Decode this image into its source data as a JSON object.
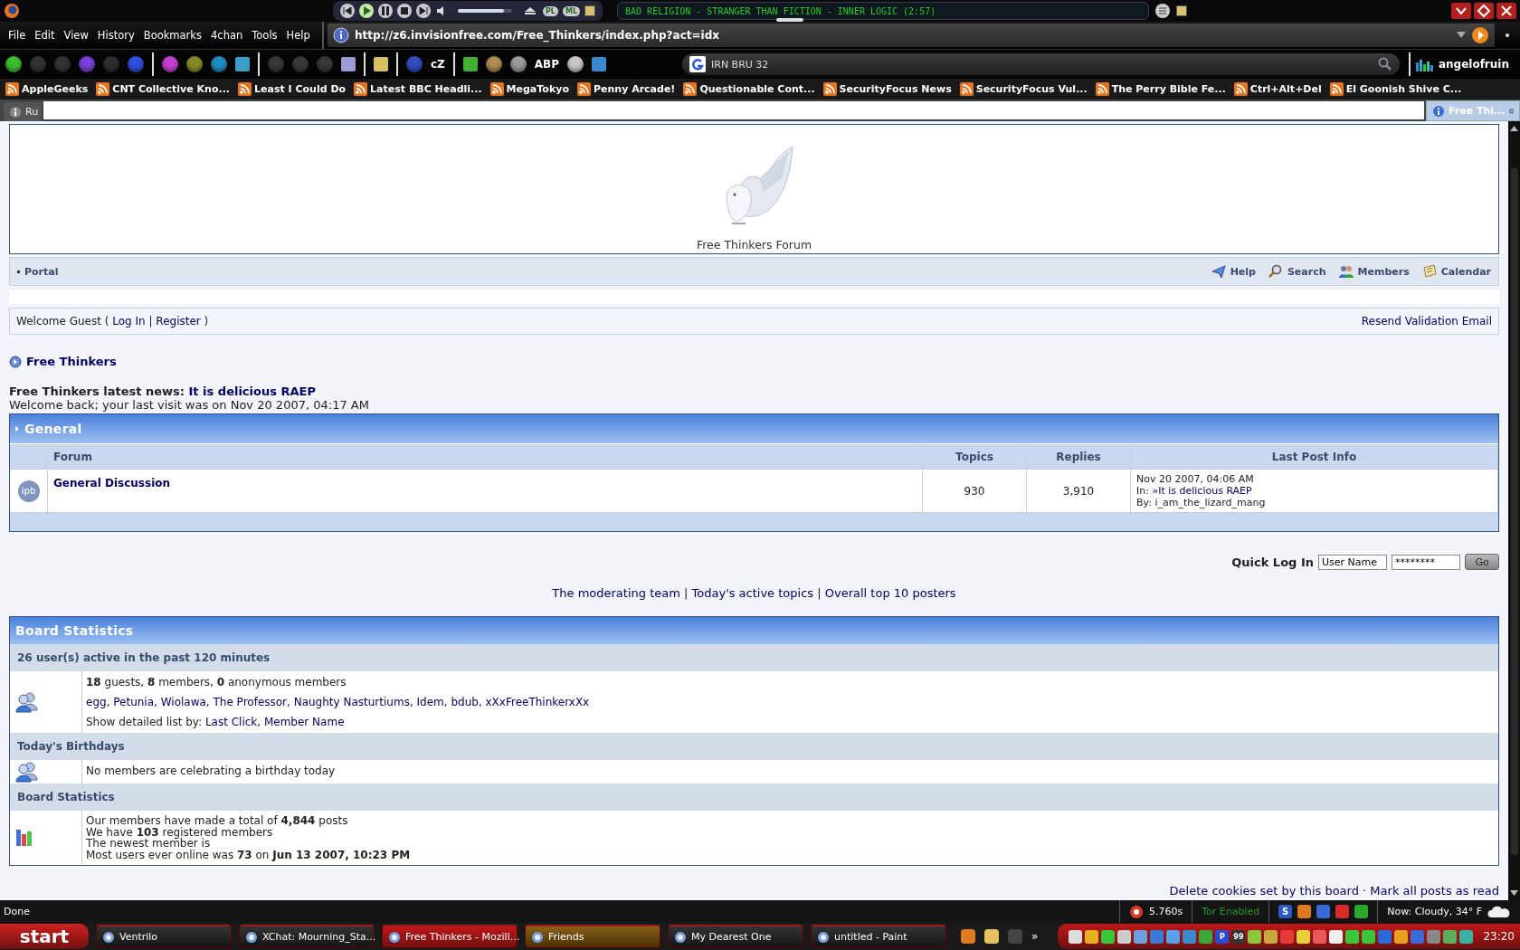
{
  "player": {
    "buttons": [
      {
        "kind": "prev"
      },
      {
        "kind": "play"
      },
      {
        "kind": "pause"
      },
      {
        "kind": "stop"
      },
      {
        "kind": "next"
      }
    ],
    "volume": {
      "level": 0.85
    },
    "labels": [
      "PL",
      "ML"
    ],
    "track": "BAD RELIGION - STRANGER THAN FICTION - INNER LOGIC (2:57)",
    "seek": {
      "level": 0.31
    }
  },
  "menu": [
    "File",
    "Edit",
    "View",
    "History",
    "Bookmarks",
    "4chan",
    "Tools",
    "Help"
  ],
  "url": "http://z6.invisionfree.com/Free_Thinkers/index.php?act=idx",
  "toolbar": [
    {
      "kind": "round",
      "color": "#3fbf2f"
    },
    {
      "kind": "round",
      "color": "#333333"
    },
    {
      "kind": "round",
      "color": "#333333"
    },
    {
      "kind": "round",
      "color": "#7a3fd8"
    },
    {
      "kind": "round",
      "color": "#2e2e2e"
    },
    {
      "kind": "round",
      "color": "#2f4fe0"
    },
    {
      "kind": "sep"
    },
    {
      "kind": "round",
      "color": "#c73fd0"
    },
    {
      "kind": "round",
      "color": "#8a8a2a"
    },
    {
      "kind": "round",
      "color": "#1f8fc0"
    },
    {
      "kind": "square",
      "color": "#3a9fc8"
    },
    {
      "kind": "sep"
    },
    {
      "kind": "round",
      "color": "#3a3a3a"
    },
    {
      "kind": "round",
      "color": "#3a3a3a"
    },
    {
      "kind": "round",
      "color": "#3a3a3a"
    },
    {
      "kind": "square",
      "color": "#9a9ad8"
    },
    {
      "kind": "sep"
    },
    {
      "kind": "square",
      "color": "#d8c060"
    },
    {
      "kind": "sep"
    },
    {
      "kind": "round",
      "color": "#3050c0"
    },
    {
      "kind": "text",
      "label": "cZ"
    },
    {
      "kind": "sep"
    },
    {
      "kind": "square",
      "color": "#3fb030"
    },
    {
      "kind": "round",
      "color": "#b08a50"
    },
    {
      "kind": "round",
      "color": "#9a9a9a"
    },
    {
      "kind": "text",
      "label": "ABP"
    },
    {
      "kind": "round",
      "color": "#c8c8c8"
    },
    {
      "kind": "square",
      "color": "#3a8ad0"
    }
  ],
  "search": {
    "value": "IRN BRU 32"
  },
  "user": "angelofruin",
  "bookmarks": [
    "AppleGeeks",
    "CNT Collective Kno...",
    "Least I Could Do",
    "Latest BBC Headli...",
    "MegaTokyo",
    "Penny Arcade!",
    "Questionable Cont...",
    "SecurityFocus News",
    "SecurityFocus Vul...",
    "The Perry Bible Fe...",
    "Ctrl+Alt+Del",
    "El Goonish Shive C..."
  ],
  "tabs": [
    {
      "label": "Ru",
      "selected": false
    },
    {
      "label": "Free Thi...",
      "selected": true
    }
  ],
  "page": {
    "title": "Free Thinkers Forum",
    "nav_left": "Portal",
    "nav_right": [
      {
        "kind": "help",
        "label": "Help"
      },
      {
        "kind": "search",
        "label": "Search"
      },
      {
        "kind": "members",
        "label": "Members"
      },
      {
        "kind": "calendar",
        "label": "Calendar"
      }
    ],
    "welcome": {
      "prefix": "Welcome Guest ( ",
      "links": [
        "Log In",
        "Register"
      ],
      "separator": " | ",
      "suffix": " )",
      "right": "Resend Validation Email"
    },
    "breadcrumb": "Free Thinkers",
    "news": {
      "label": "Free Thinkers latest news: ",
      "link": "It is delicious RAEP",
      "last_visit": "Welcome back; your last visit was on Nov 20 2007, 04:17 AM"
    },
    "category": {
      "title": "General",
      "columns": [
        "Forum",
        "Topics",
        "Replies",
        "Last Post Info"
      ],
      "rows": [
        {
          "icon_label": "ipb",
          "forum": "General Discussion",
          "topics": "930",
          "replies": "3,910",
          "last_date": "Nov 20 2007, 04:06 AM",
          "last_in": "In: ",
          "last_topic": "»It is delicious RAEP",
          "last_by": "By: i_am_the_lizard_mang"
        }
      ]
    },
    "quick_login": {
      "label": "Quick Log In",
      "username": "User Name",
      "password": "********",
      "button": "Go"
    },
    "links": {
      "items": [
        "The moderating team",
        "Today's active topics",
        "Overall top 10 posters"
      ],
      "separator": " | "
    },
    "stats": {
      "title": "Board Statistics",
      "sections": [
        {
          "title": "26 user(s) active in the past 120 minutes",
          "kind": "users",
          "lines": [
            {
              "kind": "text",
              "text": "**18** guests, **8** members, **0** anonymous members"
            },
            {
              "kind": "links",
              "links": [
                "egg",
                "Petunia",
                "Wiolawa",
                "The Professor",
                "Naughty Nasturtiums",
                "Idem",
                "bdub",
                "xXxFreeThinkerxXx"
              ],
              "separator": ", "
            },
            {
              "kind": "links",
              "prefix": "Show detailed list by: ",
              "links": [
                "Last Click",
                "Member Name"
              ],
              "separator": ", "
            }
          ]
        },
        {
          "title": "Today's Birthdays",
          "kind": "users",
          "lines": [
            {
              "kind": "text",
              "text": "No members are celebrating a birthday today"
            }
          ]
        },
        {
          "title": "Board Statistics",
          "kind": "chart",
          "lines": [
            {
              "kind": "plain",
              "text": "Our members have made a total of **4,844** posts"
            },
            {
              "kind": "plain",
              "text": "We have **103** registered members"
            },
            {
              "kind": "plain",
              "text": "The newest member is"
            },
            {
              "kind": "plain",
              "text": "Most users ever online was **73** on **Jun 13 2007, 10:23 PM**"
            }
          ]
        }
      ]
    },
    "footer": {
      "items": [
        "Delete cookies set by this board",
        "Mark all posts as read"
      ],
      "separator": " · "
    }
  },
  "status_bar": {
    "text": "Done",
    "timing": "5.760s",
    "tor": "Tor Enabled",
    "icons": [
      {
        "label": "S",
        "color": "#2a5ac8"
      },
      {
        "color": "#e07a20"
      },
      {
        "color": "#3a6ad8"
      },
      {
        "color": "#d82a2a"
      },
      {
        "color": "#2aa82a"
      }
    ],
    "weather": "Now: Cloudy, 34° F"
  },
  "taskbar": {
    "start": "start",
    "tasks": [
      {
        "label": "Ventrilo",
        "selected": false,
        "flashing": false
      },
      {
        "label": "XChat: Mourning_Sta...",
        "selected": false,
        "flashing": false
      },
      {
        "label": "Free Thinkers - Mozill...",
        "selected": true,
        "flashing": false
      },
      {
        "label": "Friends",
        "selected": false,
        "flashing": true
      },
      {
        "label": "My Dearest One",
        "selected": false,
        "flashing": false
      },
      {
        "label": "untitled - Paint",
        "selected": false,
        "flashing": false
      }
    ],
    "quick_launch": [
      {
        "color": "#e07a20"
      },
      {
        "color": "#e8c060"
      },
      {
        "color": "#444444"
      }
    ],
    "more": "»",
    "tray": [
      {
        "color": "#dddddd"
      },
      {
        "color": "#e8b020"
      },
      {
        "color": "#3ac83a"
      },
      {
        "color": "#cccccc"
      },
      {
        "color": "#6aa0e0"
      },
      {
        "color": "#3a7ad8"
      },
      {
        "color": "#5aa0e8"
      },
      {
        "color": "#3a8ad0"
      },
      {
        "color": "#3aa83a"
      },
      {
        "color": "#2a4ad8",
        "label": "P"
      },
      {
        "color": "#333333",
        "label": "99"
      },
      {
        "color": "#8ac83a"
      },
      {
        "color": "#c8a83a"
      },
      {
        "color": "#e83a3a"
      },
      {
        "color": "#e8d03a"
      },
      {
        "color": "#e85a5a"
      },
      {
        "color": "#eeeeee"
      },
      {
        "color": "#3ac83a"
      },
      {
        "color": "#3ac83a"
      },
      {
        "color": "#2a6ad8"
      },
      {
        "color": "#e8a020"
      },
      {
        "color": "#3a6ad8"
      },
      {
        "color": "#888888"
      },
      {
        "color": "#5ab05a"
      },
      {
        "color": "#3ab0a0"
      }
    ],
    "clock": "23:20"
  }
}
